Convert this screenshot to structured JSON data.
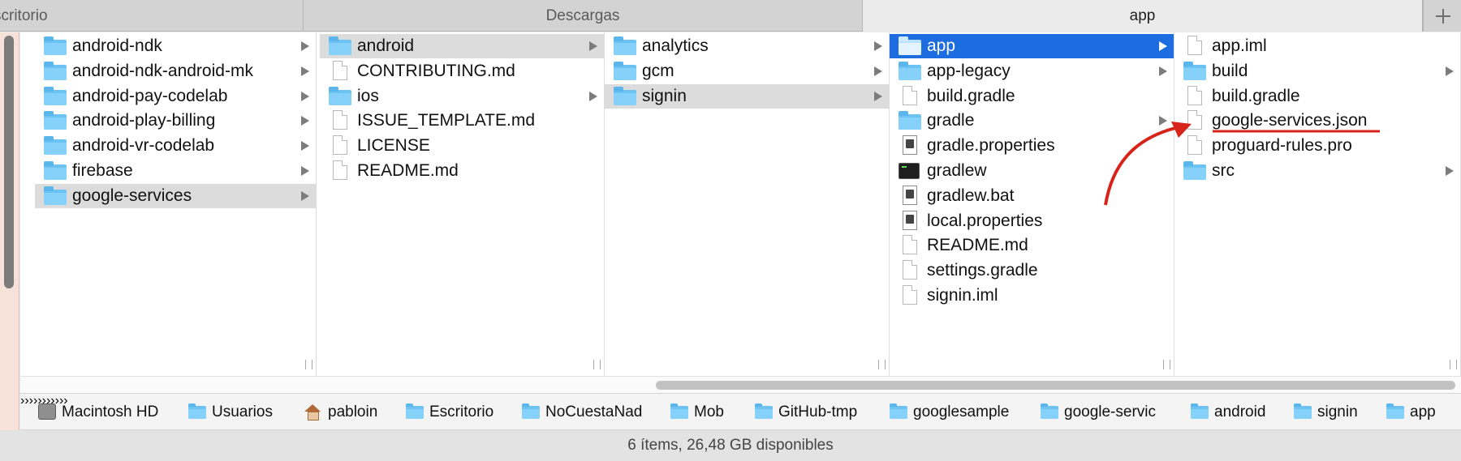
{
  "tabs": [
    {
      "label": "scritorio"
    },
    {
      "label": "Descargas"
    },
    {
      "label": "app"
    }
  ],
  "columns": [
    {
      "items": [
        {
          "label": "android-ndk",
          "type": "folder",
          "arrow": true
        },
        {
          "label": "android-ndk-android-mk",
          "type": "folder",
          "arrow": true
        },
        {
          "label": "android-pay-codelab",
          "type": "folder",
          "arrow": true
        },
        {
          "label": "android-play-billing",
          "type": "folder",
          "arrow": true
        },
        {
          "label": "android-vr-codelab",
          "type": "folder",
          "arrow": true
        },
        {
          "label": "firebase",
          "type": "folder",
          "arrow": true
        },
        {
          "label": "google-services",
          "type": "folder",
          "arrow": true,
          "selected": "gray"
        }
      ]
    },
    {
      "items": [
        {
          "label": "android",
          "type": "folder",
          "arrow": true,
          "selected": "gray"
        },
        {
          "label": "CONTRIBUTING.md",
          "type": "doc"
        },
        {
          "label": "ios",
          "type": "folder",
          "arrow": true
        },
        {
          "label": "ISSUE_TEMPLATE.md",
          "type": "doc"
        },
        {
          "label": "LICENSE",
          "type": "doc"
        },
        {
          "label": "README.md",
          "type": "doc"
        }
      ]
    },
    {
      "items": [
        {
          "label": "analytics",
          "type": "folder",
          "arrow": true
        },
        {
          "label": "gcm",
          "type": "folder",
          "arrow": true
        },
        {
          "label": "signin",
          "type": "folder",
          "arrow": true,
          "selected": "gray"
        }
      ]
    },
    {
      "items": [
        {
          "label": "app",
          "type": "folder",
          "arrow": true,
          "selected": "blue"
        },
        {
          "label": "app-legacy",
          "type": "folder",
          "arrow": true
        },
        {
          "label": "build.gradle",
          "type": "doc"
        },
        {
          "label": "gradle",
          "type": "folder",
          "arrow": true
        },
        {
          "label": "gradle.properties",
          "type": "propdoc"
        },
        {
          "label": "gradlew",
          "type": "term"
        },
        {
          "label": "gradlew.bat",
          "type": "propdoc"
        },
        {
          "label": "local.properties",
          "type": "propdoc"
        },
        {
          "label": "README.md",
          "type": "doc"
        },
        {
          "label": "settings.gradle",
          "type": "doc"
        },
        {
          "label": "signin.iml",
          "type": "doc"
        }
      ]
    },
    {
      "items": [
        {
          "label": "app.iml",
          "type": "doc"
        },
        {
          "label": "build",
          "type": "folder",
          "arrow": true
        },
        {
          "label": "build.gradle",
          "type": "doc"
        },
        {
          "label": "google-services.json",
          "type": "doc",
          "highlight": true
        },
        {
          "label": "proguard-rules.pro",
          "type": "doc"
        },
        {
          "label": "src",
          "type": "folder",
          "arrow": true
        }
      ]
    }
  ],
  "path": [
    {
      "label": "Macintosh HD",
      "icon": "hard-drive-icon"
    },
    {
      "label": "Usuarios",
      "icon": "users-folder-icon"
    },
    {
      "label": "pabloin",
      "icon": "home-icon"
    },
    {
      "label": "Escritorio",
      "icon": "desktop-folder-icon"
    },
    {
      "label": "NoCuestaNad",
      "icon": "folder-icon"
    },
    {
      "label": "Mob",
      "icon": "folder-icon"
    },
    {
      "label": "GitHub-tmp",
      "icon": "folder-icon"
    },
    {
      "label": "googlesample",
      "icon": "folder-icon"
    },
    {
      "label": "google-servic",
      "icon": "folder-icon"
    },
    {
      "label": "android",
      "icon": "folder-icon"
    },
    {
      "label": "signin",
      "icon": "folder-icon"
    },
    {
      "label": "app",
      "icon": "folder-icon"
    }
  ],
  "status": {
    "text": "6 ítems, 26,48 GB disponibles"
  },
  "colors": {
    "selection_blue": "#1d6ce0",
    "annotation_red": "#d8231a",
    "folder": "#6cc3f3"
  }
}
